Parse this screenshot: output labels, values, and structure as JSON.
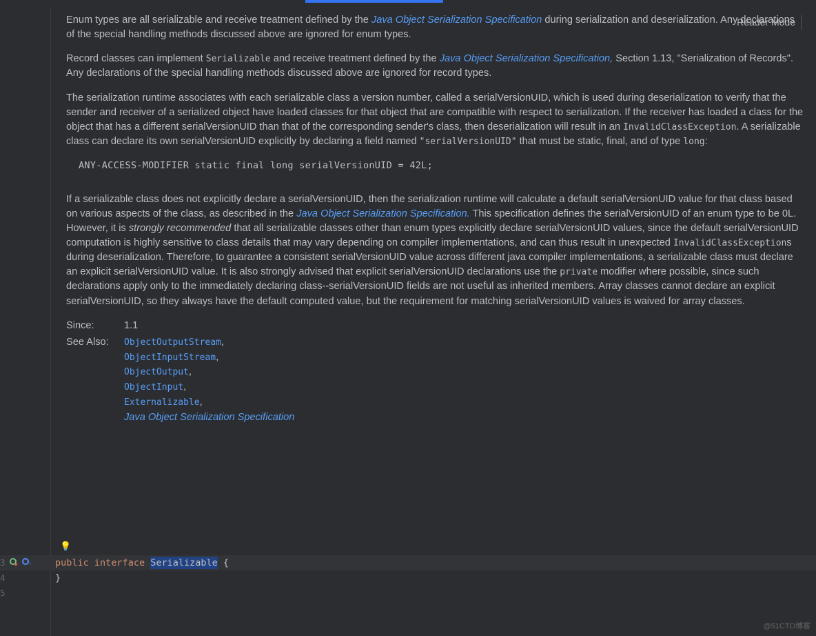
{
  "reader_mode_label": "Reader Mode",
  "p1": {
    "a": "Enum types are all serializable and receive treatment defined by the ",
    "link": "Java Object Serialization Specification",
    "b": " during serialization and deserialization. Any declarations of the special handling methods discussed above are ignored for enum types."
  },
  "p2": {
    "a": "Record classes can implement ",
    "code": "Serializable",
    "b": " and receive treatment defined by the ",
    "link": "Java Object Serialization Specification,",
    "c": " Section 1.13, \"Serialization of Records\". Any declarations of the special handling methods discussed above are ignored for record types."
  },
  "p3": {
    "a": "The serialization runtime associates with each serializable class a version number, called a serialVersionUID, which is used during deserialization to verify that the sender and receiver of a serialized object have loaded classes for that object that are compatible with respect to serialization. If the receiver has loaded a class for the object that has a different serialVersionUID than that of the corresponding sender's class, then deserialization will result in an ",
    "code1": "InvalidClassException",
    "b": ". A serializable class can declare its own serialVersionUID explicitly by declaring a field named ",
    "code2": "\"serialVersionUID\"",
    "c": " that must be static, final, and of type ",
    "code3": "long",
    "d": ":"
  },
  "codeblock": "ANY-ACCESS-MODIFIER static final long serialVersionUID = 42L;",
  "p4": {
    "a": "If a serializable class does not explicitly declare a serialVersionUID, then the serialization runtime will calculate a default serialVersionUID value for that class based on various aspects of the class, as described in the ",
    "link1": "Java Object Serialization Specification.",
    "b": " This specification defines the serialVersionUID of an enum type to be 0L. However, it is ",
    "em": "strongly recommended",
    "c": " that all serializable classes other than enum types explicitly declare serialVersionUID values, since the default serialVersionUID computation is highly sensitive to class details that may vary depending on compiler implementations, and can thus result in unexpected ",
    "code1": "InvalidClassException",
    "d": "s during deserialization. Therefore, to guarantee a consistent serialVersionUID value across different java compiler implementations, a serializable class must declare an explicit serialVersionUID value. It is also strongly advised that explicit serialVersionUID declarations use the ",
    "code2": "private",
    "e": " modifier where possible, since such declarations apply only to the immediately declaring class--serialVersionUID fields are not useful as inherited members. Array classes cannot declare an explicit serialVersionUID, so they always have the default computed value, but the requirement for matching serialVersionUID values is waived for array classes."
  },
  "since_label": "Since:",
  "since_value": "1.1",
  "seealso_label": "See Also:",
  "seealso": {
    "i0": "ObjectOutputStream",
    "i1": "ObjectInputStream",
    "i2": "ObjectOutput",
    "i3": "ObjectInput",
    "i4": "Externalizable",
    "i5": "Java Object Serialization Specification"
  },
  "comma": ",",
  "line_numbers": {
    "n1": "3",
    "n2": "4",
    "n3": "5"
  },
  "src": {
    "kw_public": "public",
    "kw_interface": "interface",
    "name": "Serializable",
    "open": " {",
    "close": "}"
  },
  "watermark": "@51CTO博客"
}
